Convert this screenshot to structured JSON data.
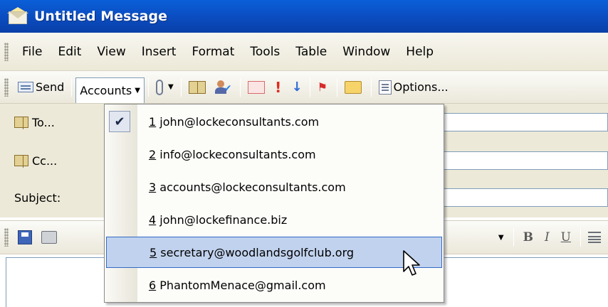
{
  "window": {
    "title": "Untitled Message"
  },
  "menubar": {
    "items": [
      {
        "label": "File"
      },
      {
        "label": "Edit"
      },
      {
        "label": "View"
      },
      {
        "label": "Insert"
      },
      {
        "label": "Format"
      },
      {
        "label": "Tools"
      },
      {
        "label": "Table"
      },
      {
        "label": "Window"
      },
      {
        "label": "Help"
      }
    ]
  },
  "toolbar": {
    "send_label": "Send",
    "accounts_label": "Accounts",
    "options_label": "Options..."
  },
  "header": {
    "to_label": "To...",
    "cc_label": "Cc...",
    "subject_label": "Subject:"
  },
  "format_toolbar": {
    "bold": "B",
    "italic": "I",
    "underline": "U"
  },
  "accounts_menu": {
    "checked_index": 0,
    "hovered_index": 4,
    "items": [
      {
        "num": "1",
        "email": "john@lockeconsultants.com"
      },
      {
        "num": "2",
        "email": "info@lockeconsultants.com"
      },
      {
        "num": "3",
        "email": "accounts@lockeconsultants.com"
      },
      {
        "num": "4",
        "email": "john@lockefinance.biz"
      },
      {
        "num": "5",
        "email": "secretary@woodlandsgolfclub.org"
      },
      {
        "num": "6",
        "email": "PhantomMenace@gmail.com"
      }
    ]
  },
  "colors": {
    "titlebar": "#0b4fc4",
    "menu_highlight": "#c1d2ee",
    "highlight_border": "#316ac5"
  }
}
